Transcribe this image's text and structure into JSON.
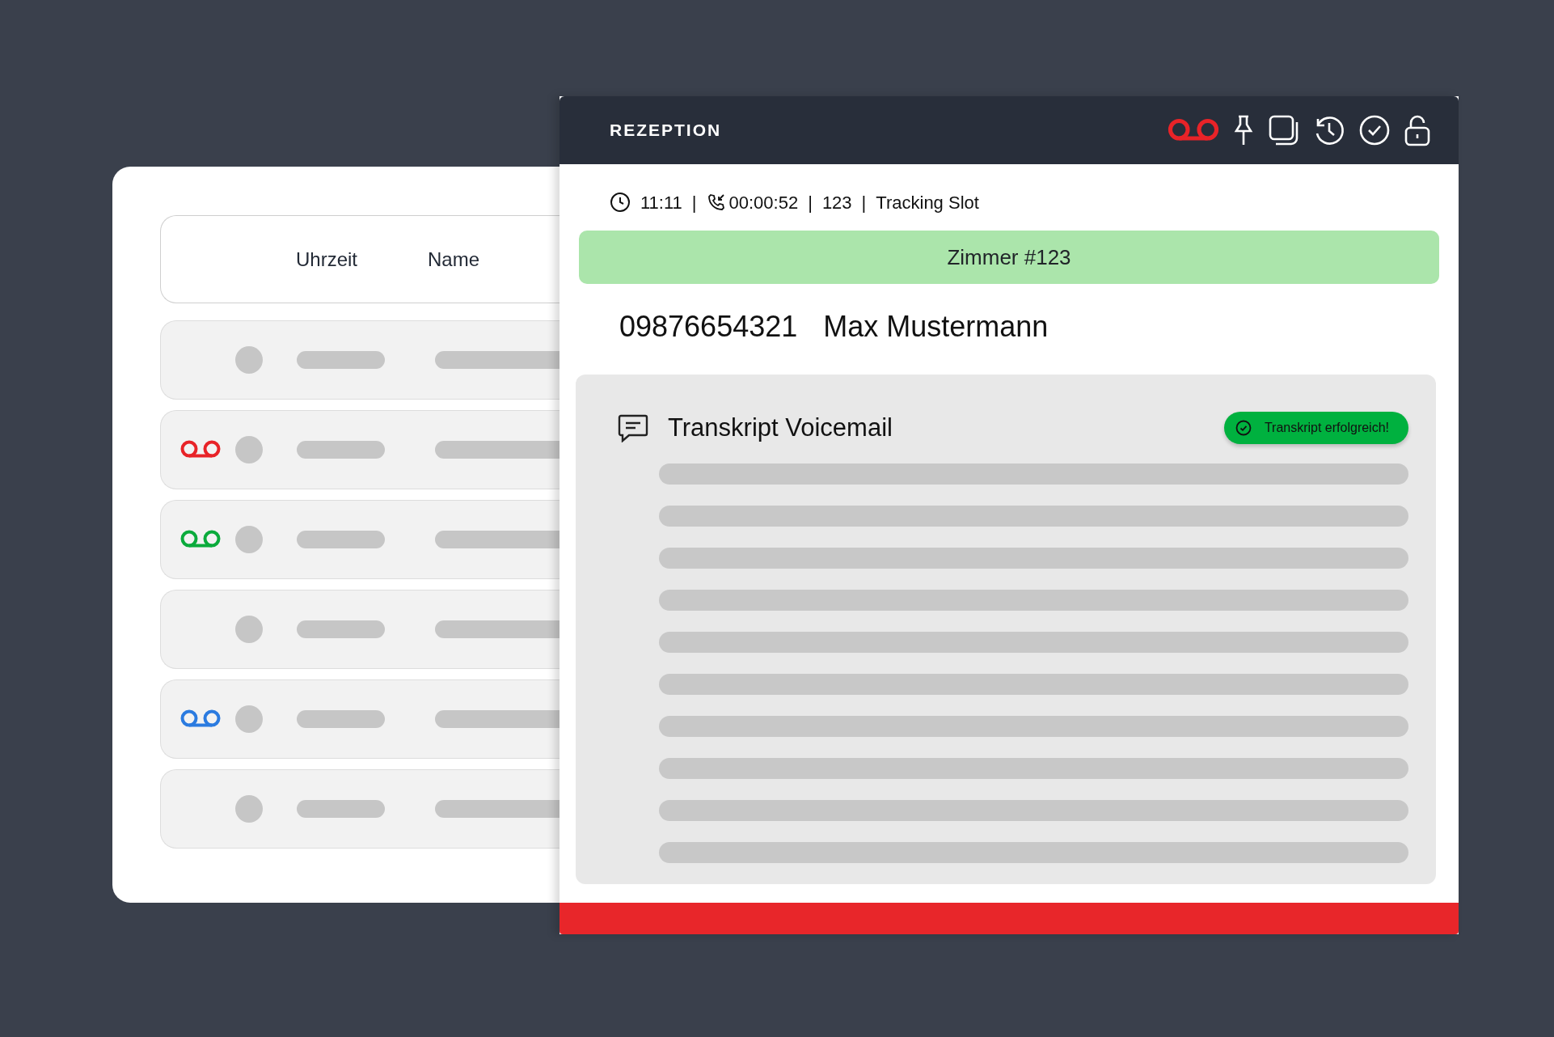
{
  "call_list": {
    "columns": [
      "Uhrzeit",
      "Name"
    ],
    "rows": [
      {
        "voicemail": false
      },
      {
        "voicemail": true,
        "color": "#e82328"
      },
      {
        "voicemail": true,
        "color": "#0bab3c"
      },
      {
        "voicemail": false
      },
      {
        "voicemail": true,
        "color": "#2b7be0"
      },
      {
        "voicemail": false
      }
    ]
  },
  "detail": {
    "title": "REZEPTION",
    "meta": [
      {
        "kind": "time",
        "text": "11:11"
      },
      {
        "kind": "separator",
        "text": "|"
      },
      {
        "kind": "duration",
        "text": "00:00:52"
      },
      {
        "kind": "separator",
        "text": "|"
      },
      {
        "kind": "extension",
        "text": "123"
      },
      {
        "kind": "separator",
        "text": "|"
      },
      {
        "kind": "slot",
        "text": "Tracking Slot"
      }
    ],
    "room": "Zimmer #123",
    "phone": "09876654321",
    "caller": "Max Mustermann",
    "transcript": {
      "title": "Transkript Voicemail",
      "status": "Transkript erfolgreich!"
    }
  }
}
